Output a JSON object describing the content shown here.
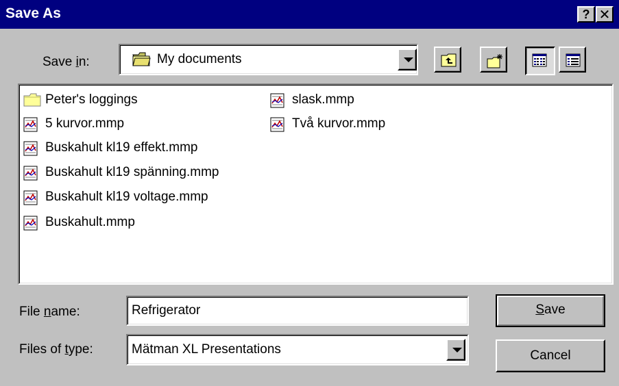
{
  "window": {
    "title": "Save As",
    "help_glyph": "?",
    "close_glyph": "✕"
  },
  "save_in": {
    "label_pre": "Save ",
    "label_u": "i",
    "label_post": "n:",
    "value": "My documents",
    "icon": "open-folder-icon"
  },
  "toolbar": {
    "up_folder_icon": "up-one-level-icon",
    "new_folder_icon": "create-new-folder-icon",
    "list_icon": "list-view-icon",
    "details_icon": "details-view-icon"
  },
  "files": [
    {
      "name": "Peter's loggings",
      "kind": "folder"
    },
    {
      "name": "5 kurvor.mmp",
      "kind": "mmp"
    },
    {
      "name": "Buskahult kl19 effekt.mmp",
      "kind": "mmp"
    },
    {
      "name": "Buskahult kl19 spänning.mmp",
      "kind": "mmp"
    },
    {
      "name": "Buskahult kl19 voltage.mmp",
      "kind": "mmp"
    },
    {
      "name": "Buskahult.mmp",
      "kind": "mmp"
    },
    {
      "name": "slask.mmp",
      "kind": "mmp"
    },
    {
      "name": "Två kurvor.mmp",
      "kind": "mmp"
    }
  ],
  "file_name": {
    "label_pre": "File ",
    "label_u": "n",
    "label_post": "ame:",
    "value": "Refrigerator"
  },
  "file_type": {
    "label_pre": "Files of ",
    "label_u": "t",
    "label_post": "ype:",
    "value": "Mätman XL Presentations"
  },
  "buttons": {
    "save_u": "S",
    "save_post": "ave",
    "cancel": "Cancel"
  },
  "colors": {
    "titlebar": "#000080",
    "face": "#c0c0c0",
    "folder": "#ffff99"
  }
}
